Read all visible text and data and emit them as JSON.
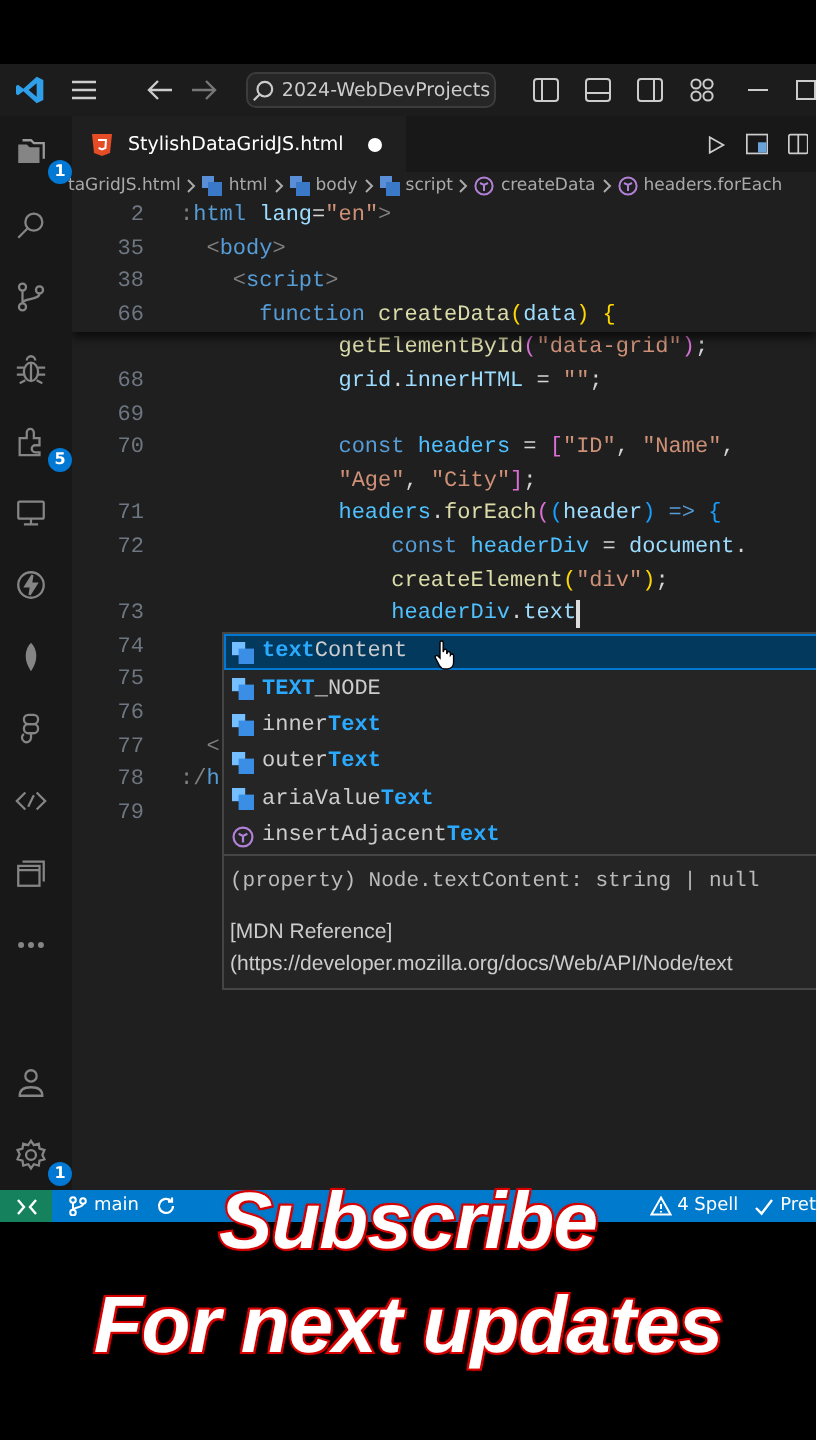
{
  "title_bar": {
    "search": "2024-WebDevProjects"
  },
  "tab": {
    "label": "StylishDataGridJS.html",
    "modified": true,
    "selected": true
  },
  "breadcrumbs": [
    {
      "kind": "file",
      "label": "taGridJS.html"
    },
    {
      "kind": "element",
      "label": "html"
    },
    {
      "kind": "element",
      "label": "body"
    },
    {
      "kind": "element",
      "label": "script"
    },
    {
      "kind": "function",
      "label": "createData"
    },
    {
      "kind": "function",
      "label": "headers.forEach"
    }
  ],
  "activity_bar": {
    "top": [
      {
        "kind": "explorer",
        "badge": "1"
      },
      {
        "kind": "search"
      },
      {
        "kind": "source-control"
      },
      {
        "kind": "debug"
      },
      {
        "kind": "extensions",
        "badge": "5"
      },
      {
        "kind": "remote"
      },
      {
        "kind": "lightning"
      },
      {
        "kind": "leaf"
      },
      {
        "kind": "figma"
      },
      {
        "kind": "code"
      },
      {
        "kind": "windows"
      },
      {
        "kind": "more"
      }
    ],
    "bottom": [
      {
        "kind": "account"
      },
      {
        "kind": "settings",
        "badge": "1"
      }
    ]
  },
  "editor": {
    "sticky": [
      {
        "number": "2",
        "tokens": [
          {
            "kind": "punct2",
            "t": ":"
          },
          {
            "kind": "tag",
            "t": "html"
          },
          {
            "kind": "attr",
            "t": " lang"
          },
          {
            "kind": "plain",
            "t": "="
          },
          {
            "kind": "str",
            "t": "\"en\""
          },
          {
            "kind": "punct2",
            "t": ">"
          }
        ]
      },
      {
        "number": "35",
        "tokens": [
          {
            "kind": "punct2",
            "t": "  <"
          },
          {
            "kind": "tag",
            "t": "body"
          },
          {
            "kind": "punct2",
            "t": ">"
          }
        ]
      },
      {
        "number": "38",
        "tokens": [
          {
            "kind": "punct2",
            "t": "    <"
          },
          {
            "kind": "tag",
            "t": "script"
          },
          {
            "kind": "punct2",
            "t": ">"
          }
        ]
      },
      {
        "number": "66",
        "tokens": [
          {
            "kind": "kw",
            "t": "      function"
          },
          {
            "kind": "fn",
            "t": " createData"
          },
          {
            "kind": "b1",
            "t": "("
          },
          {
            "kind": "var",
            "t": "data"
          },
          {
            "kind": "b1",
            "t": ")"
          },
          {
            "kind": "b1",
            "t": " {"
          }
        ]
      }
    ],
    "lines": [
      {
        "tokens": [
          {
            "kind": "fn",
            "t": "            getElementById"
          },
          {
            "kind": "b2",
            "t": "("
          },
          {
            "kind": "str",
            "t": "\"data-grid\""
          },
          {
            "kind": "b2",
            "t": ")"
          },
          {
            "kind": "plain",
            "t": ";"
          }
        ]
      },
      {
        "number": "68",
        "tokens": [
          {
            "kind": "var",
            "t": "            grid"
          },
          {
            "kind": "plain",
            "t": "."
          },
          {
            "kind": "var",
            "t": "innerHTML"
          },
          {
            "kind": "plain",
            "t": " = "
          },
          {
            "kind": "str",
            "t": "\"\""
          },
          {
            "kind": "plain",
            "t": ";"
          }
        ]
      },
      {
        "number": "69"
      },
      {
        "number": "70",
        "tokens": [
          {
            "kind": "kw",
            "t": "            const"
          },
          {
            "kind": "const",
            "t": " headers"
          },
          {
            "kind": "plain",
            "t": " = "
          },
          {
            "kind": "b2",
            "t": "["
          },
          {
            "kind": "str",
            "t": "\"ID\""
          },
          {
            "kind": "plain",
            "t": ", "
          },
          {
            "kind": "str",
            "t": "\"Name\""
          },
          {
            "kind": "plain",
            "t": ","
          }
        ]
      },
      {
        "tokens": [
          {
            "kind": "str",
            "t": "            \"Age\""
          },
          {
            "kind": "plain",
            "t": ", "
          },
          {
            "kind": "str",
            "t": "\"City\""
          },
          {
            "kind": "b2",
            "t": "]"
          },
          {
            "kind": "plain",
            "t": ";"
          }
        ]
      },
      {
        "number": "71",
        "tokens": [
          {
            "kind": "const",
            "t": "            headers"
          },
          {
            "kind": "plain",
            "t": "."
          },
          {
            "kind": "fn",
            "t": "forEach"
          },
          {
            "kind": "b2",
            "t": "("
          },
          {
            "kind": "b3",
            "t": "("
          },
          {
            "kind": "var",
            "t": "header"
          },
          {
            "kind": "b3",
            "t": ")"
          },
          {
            "kind": "kw",
            "t": " =>"
          },
          {
            "kind": "b3",
            "t": " {"
          }
        ]
      },
      {
        "number": "72",
        "tokens": [
          {
            "kind": "kw",
            "t": "                const"
          },
          {
            "kind": "const",
            "t": " headerDiv"
          },
          {
            "kind": "plain",
            "t": " = "
          },
          {
            "kind": "var",
            "t": "document"
          },
          {
            "kind": "plain",
            "t": "."
          }
        ]
      },
      {
        "tokens": [
          {
            "kind": "fn",
            "t": "                createElement"
          },
          {
            "kind": "b1",
            "t": "("
          },
          {
            "kind": "str",
            "t": "\"div\""
          },
          {
            "kind": "b1",
            "t": ")"
          },
          {
            "kind": "plain",
            "t": ";"
          }
        ]
      },
      {
        "number": "73",
        "cursor": true,
        "tokens": [
          {
            "kind": "const",
            "t": "                headerDiv"
          },
          {
            "kind": "plain",
            "t": "."
          },
          {
            "kind": "var",
            "t": "text"
          }
        ]
      },
      {
        "number": "74"
      },
      {
        "number": "75"
      },
      {
        "number": "76"
      },
      {
        "number": "77",
        "tokens": [
          {
            "kind": "punct2",
            "t": "  <"
          }
        ]
      },
      {
        "number": "78",
        "tokens": [
          {
            "kind": "punct2",
            "t": ":/"
          },
          {
            "kind": "tag",
            "t": "h"
          }
        ]
      },
      {
        "number": "79"
      }
    ]
  },
  "suggestions": [
    {
      "kind": "property",
      "selected": true,
      "parts": [
        {
          "t": "text",
          "match": true
        },
        {
          "t": "Content",
          "match": false
        }
      ]
    },
    {
      "kind": "property",
      "selected": false,
      "parts": [
        {
          "t": "TEXT",
          "match": true
        },
        {
          "t": "_NODE",
          "match": false
        }
      ]
    },
    {
      "kind": "property",
      "selected": false,
      "parts": [
        {
          "t": "inner",
          "match": false
        },
        {
          "t": "Text",
          "match": true
        }
      ]
    },
    {
      "kind": "property",
      "selected": false,
      "parts": [
        {
          "t": "outer",
          "match": false
        },
        {
          "t": "Text",
          "match": true
        }
      ]
    },
    {
      "kind": "property",
      "selected": false,
      "parts": [
        {
          "t": "ariaValue",
          "match": false
        },
        {
          "t": "Text",
          "match": true
        }
      ]
    },
    {
      "kind": "method",
      "selected": false,
      "parts": [
        {
          "t": "insertAdjacent",
          "match": false
        },
        {
          "t": "Text",
          "match": true
        }
      ]
    }
  ],
  "doc": {
    "signature": "(property) Node.textContent: string | null",
    "link_label": "[MDN Reference]",
    "url": "(https://developer.mozilla.org/docs/Web/API/Node/text"
  },
  "status_bar": {
    "left": [
      {
        "kind": "remote"
      },
      {
        "kind": "branch",
        "label": "main"
      },
      {
        "kind": "sync"
      }
    ],
    "right": [
      {
        "kind": "warning",
        "label": "4 Spell"
      },
      {
        "kind": "check",
        "label": "Pret"
      }
    ]
  },
  "overlay": {
    "lines": [
      "Subscribe",
      "For next updates"
    ]
  }
}
